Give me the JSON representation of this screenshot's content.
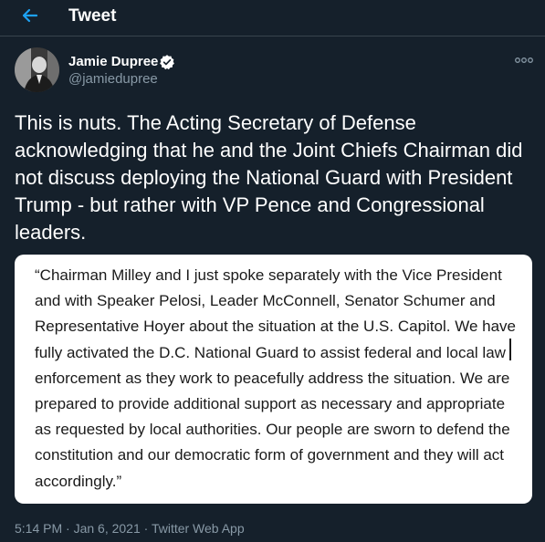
{
  "header": {
    "title": "Tweet"
  },
  "tweet": {
    "author_name": "Jamie Dupree",
    "author_handle": "@jamiedupree",
    "text": "This is nuts.  The Acting Secretary of Defense acknowledging that he and the Joint Chiefs Chairman did not discuss deploying the National Guard with President Trump - but rather with VP Pence and Congressional leaders.",
    "quote_image_text": "“Chairman Milley and I just spoke separately with the Vice President and with Speaker Pelosi, Leader McConnell, Senator Schumer and Representative Hoyer about the situation at the U.S. Capitol. We have fully activated the D.C. National Guard to assist federal and local law enforcement as they work to peacefully address the situation. We are prepared to provide additional support as necessary and appropriate as requested by local authorities. Our people are sworn to defend the constitution and our democratic form of government and they will act accordingly.”",
    "timestamp": "5:14 PM · Jan 6, 2021 · Twitter Web App"
  },
  "icons": {
    "back": "arrow-left-icon",
    "verified": "verified-badge-icon",
    "more": "more-options-icon"
  },
  "colors": {
    "background": "#15202b",
    "accent": "#1da1f2",
    "secondary_text": "#8899a6",
    "divider": "#38444d"
  }
}
